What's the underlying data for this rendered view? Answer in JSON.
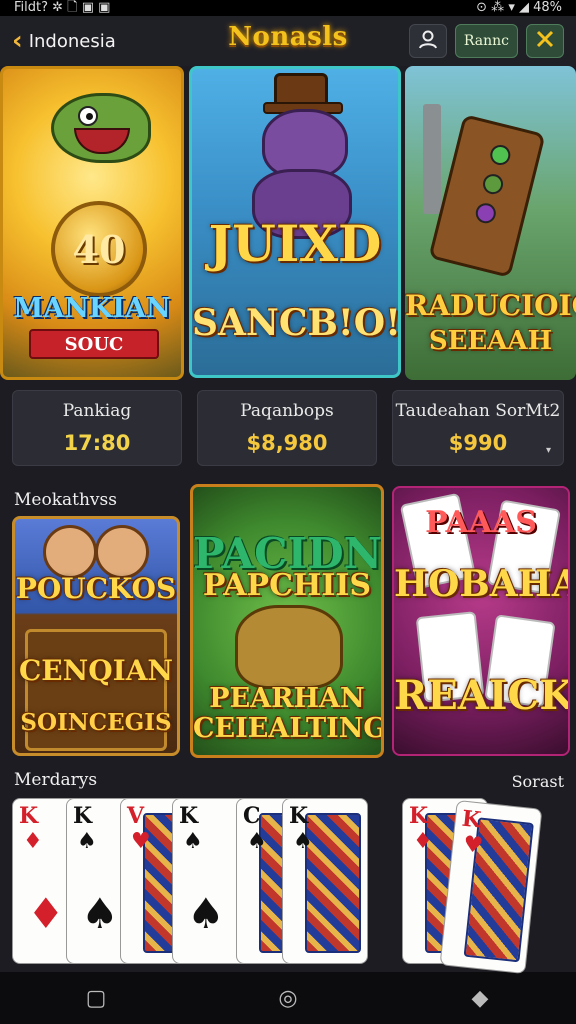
{
  "status_bar": {
    "left_text": "Fildt? ✲ 🗋 ▣ ▣",
    "right_text": "⊙ ⁂ ▾ ◢ 48%"
  },
  "header": {
    "back_label": "Indonesia",
    "logo_text": "Nonasls",
    "button_text": "Rannc",
    "icons": [
      "chevron-left",
      "search-person",
      "tools"
    ]
  },
  "featured": [
    {
      "title": "MANKIAN",
      "ribbon": "SOUC",
      "coin": "40"
    },
    {
      "title1": "JUIXD",
      "title2": "SANCB!O!"
    },
    {
      "title1": "RADUCIOIG",
      "title2": "SEEAAH"
    }
  ],
  "stats": [
    {
      "label": "Pankiag",
      "value": "17:80"
    },
    {
      "label": "Paqanbops",
      "value": "$8,980"
    },
    {
      "label": "Taudeahan SorMt2",
      "value": "$990",
      "caret": "▾"
    }
  ],
  "sections": {
    "first": "Meokathvss",
    "second": "Merdarys",
    "second_right": "Sorast"
  },
  "games": [
    {
      "title1": "POUCKOS",
      "title2": "CENQIAN",
      "title3": "SOINCEGIS"
    },
    {
      "title1": "PACIDN",
      "title2": "PAPCHIIS",
      "title3": "PEARHAN",
      "title4": "CEIEALTING"
    },
    {
      "title1": "PAAAS",
      "title2": "HOBAHA",
      "title3": "REAICKE"
    }
  ],
  "cards": [
    {
      "rank": "K",
      "suit": "♦",
      "color": "red"
    },
    {
      "rank": "K",
      "suit": "♠",
      "color": "black"
    },
    {
      "rank": "V",
      "suit": "♥",
      "color": "red"
    },
    {
      "rank": "K",
      "suit": "♠",
      "color": "black"
    },
    {
      "rank": "C",
      "suit": "♠",
      "color": "black"
    },
    {
      "rank": "K",
      "suit": "♠",
      "color": "black"
    },
    {
      "rank": "K",
      "suit": "♦",
      "color": "red"
    },
    {
      "rank": "K",
      "suit": "♥",
      "color": "red"
    }
  ],
  "nav": {
    "back": "▢",
    "home": "◎",
    "recents": "◆"
  }
}
